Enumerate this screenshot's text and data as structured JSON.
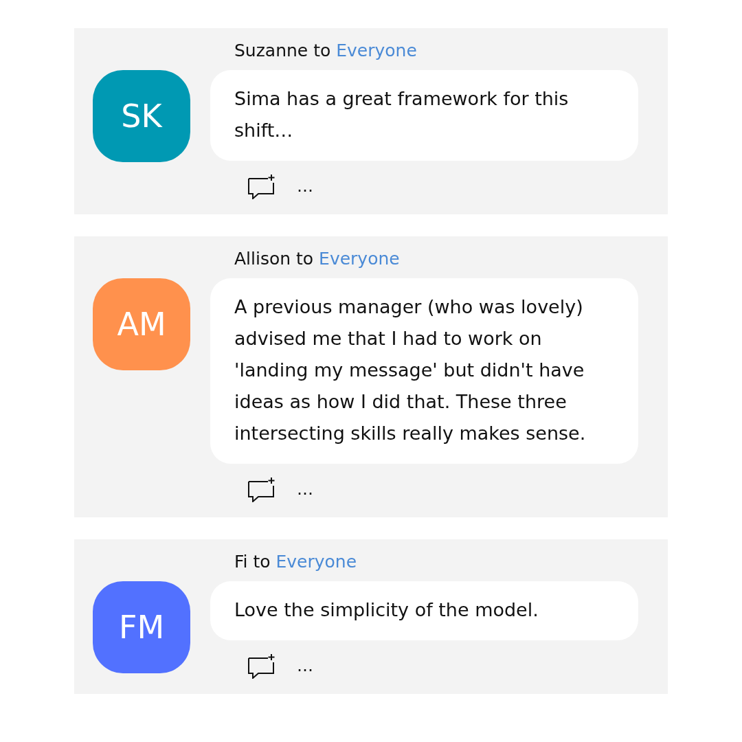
{
  "messages": [
    {
      "sender": "Suzanne",
      "connector": "to",
      "recipient": "Everyone",
      "initials": "SK",
      "color": "#0099b3",
      "text": "Sima has a great framework for this shift…",
      "more": "…"
    },
    {
      "sender": "Allison",
      "connector": "to",
      "recipient": "Everyone",
      "initials": "AM",
      "color": "#ff914d",
      "text": "A previous manager (who was lovely) advised me that I had to work on 'landing my message' but didn't have ideas as how I did that. These three intersecting skills really makes sense.",
      "more": "…"
    },
    {
      "sender": "Fi",
      "connector": "to",
      "recipient": "Everyone",
      "initials": "FM",
      "color": "#5271ff",
      "text": "Love the simplicity of the model.",
      "more": "…"
    }
  ]
}
